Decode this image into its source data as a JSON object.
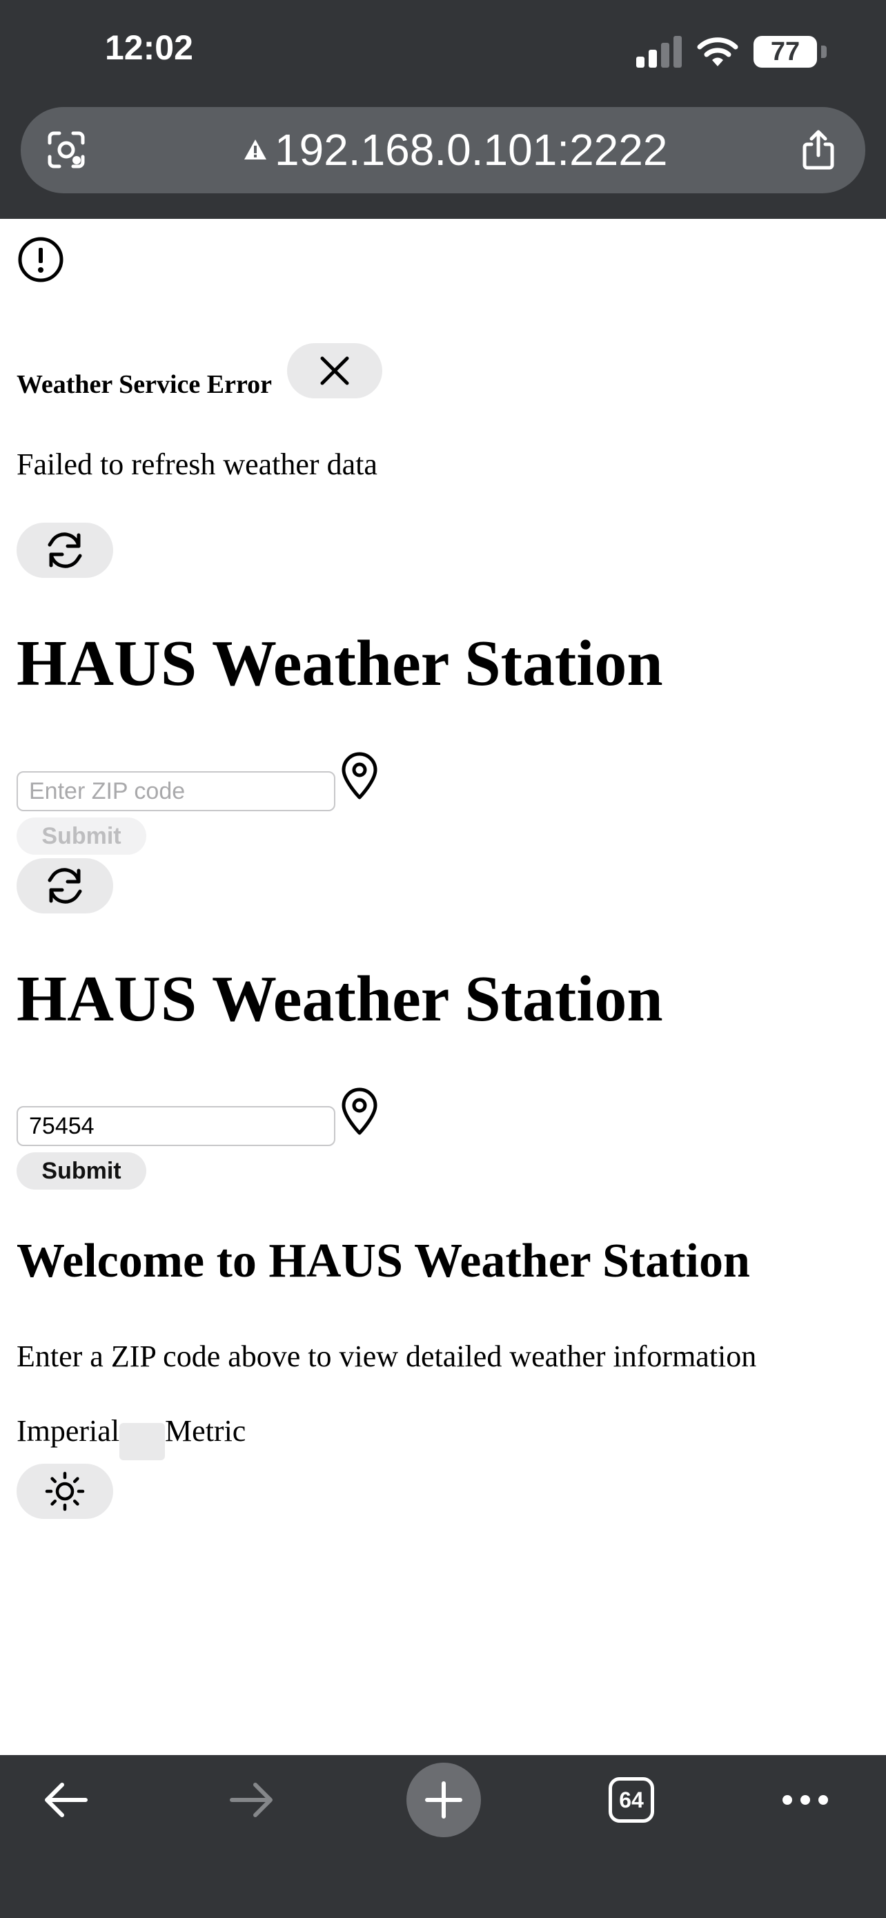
{
  "status_bar": {
    "time": "12:02",
    "battery": "77"
  },
  "browser": {
    "url": "192.168.0.101:2222",
    "tab_count": "64"
  },
  "error": {
    "title": "Weather Service Error",
    "message": "Failed to refresh weather data"
  },
  "section_initial": {
    "title": "HAUS Weather Station",
    "zip_placeholder": "Enter ZIP code",
    "zip_value": "",
    "submit_label": "Submit"
  },
  "section_active": {
    "title": "HAUS Weather Station",
    "zip_placeholder": "Enter ZIP code",
    "zip_value": "75454",
    "submit_label": "Submit"
  },
  "welcome": {
    "heading": "Welcome to HAUS Weather Station",
    "info": "Enter a ZIP code above to view detailed weather information"
  },
  "units": {
    "imperial": "Imperial",
    "metric": "Metric"
  },
  "icons": {
    "alert": "alert-circle-icon",
    "close": "close-icon",
    "refresh": "refresh-icon",
    "location": "map-pin-icon",
    "theme": "sun-icon"
  }
}
